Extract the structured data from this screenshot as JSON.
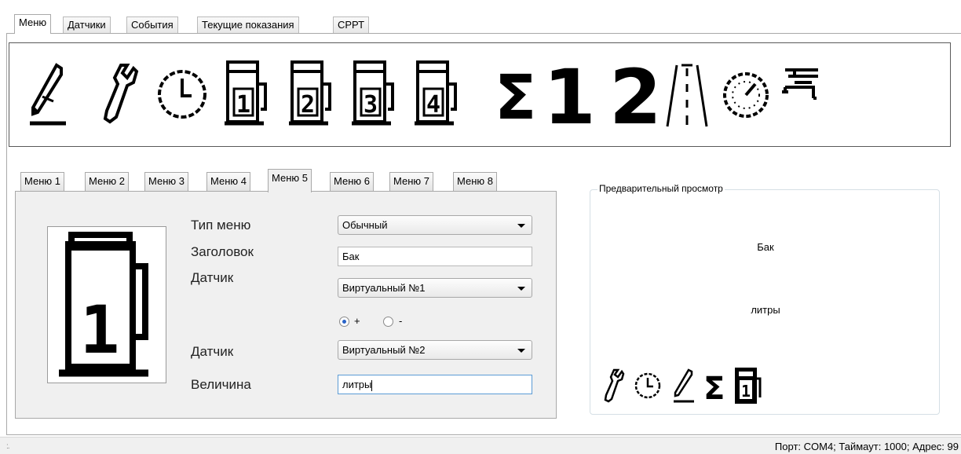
{
  "main_tabs": [
    {
      "label": "Меню",
      "active": true
    },
    {
      "label": "Датчики",
      "active": false
    },
    {
      "label": "События",
      "active": false
    },
    {
      "label": "Текущие показания",
      "active": false
    },
    {
      "label": "СРРТ",
      "active": false
    }
  ],
  "icon_strip": [
    {
      "icon": "pencil-icon"
    },
    {
      "icon": "wrench-icon"
    },
    {
      "icon": "clock-icon"
    },
    {
      "icon": "fuel-pump-1-icon",
      "text": "1"
    },
    {
      "icon": "fuel-pump-2-icon",
      "text": "2"
    },
    {
      "icon": "fuel-pump-3-icon",
      "text": "3"
    },
    {
      "icon": "fuel-pump-4-icon",
      "text": "4"
    },
    {
      "icon": "sigma-icon",
      "text": "Σ"
    },
    {
      "icon": "digit-1-icon",
      "text": "1"
    },
    {
      "icon": "digit-2-icon",
      "text": "2"
    },
    {
      "icon": "road-icon"
    },
    {
      "icon": "speedometer-icon"
    },
    {
      "icon": "faucet-icon"
    }
  ],
  "sub_tabs": [
    {
      "label": "Меню 1",
      "active": false
    },
    {
      "label": "Меню 2",
      "active": false
    },
    {
      "label": "Меню 3",
      "active": false
    },
    {
      "label": "Меню 4",
      "active": false
    },
    {
      "label": "Меню 5",
      "active": true
    },
    {
      "label": "Меню 6",
      "active": false
    },
    {
      "label": "Меню 7",
      "active": false
    },
    {
      "label": "Меню 8",
      "active": false
    }
  ],
  "form": {
    "menu_type_label": "Тип меню",
    "menu_type_value": "Обычный",
    "title_label": "Заголовок",
    "title_value": "Бак",
    "sensor1_label": "Датчик",
    "sensor1_value": "Виртуальный №1",
    "op_plus": "+",
    "op_minus": "-",
    "op_selected": "+",
    "sensor2_label": "Датчик",
    "sensor2_value": "Виртуальный №2",
    "unit_label": "Величина",
    "unit_value": "литры",
    "selected_icon": "fuel-pump-1-icon",
    "selected_icon_text": "1"
  },
  "preview": {
    "legend": "Предварительный просмотр",
    "title": "Бак",
    "unit": "литры",
    "icons": [
      "wrench-icon",
      "clock-icon",
      "pencil-icon",
      "sigma-icon",
      "fuel-pump-1-icon"
    ],
    "sigma_text": "Σ",
    "pump_text": "1"
  },
  "status_bar": {
    "text": "Порт: COM4;   Таймаут: 1000;   Адрес: 99"
  }
}
